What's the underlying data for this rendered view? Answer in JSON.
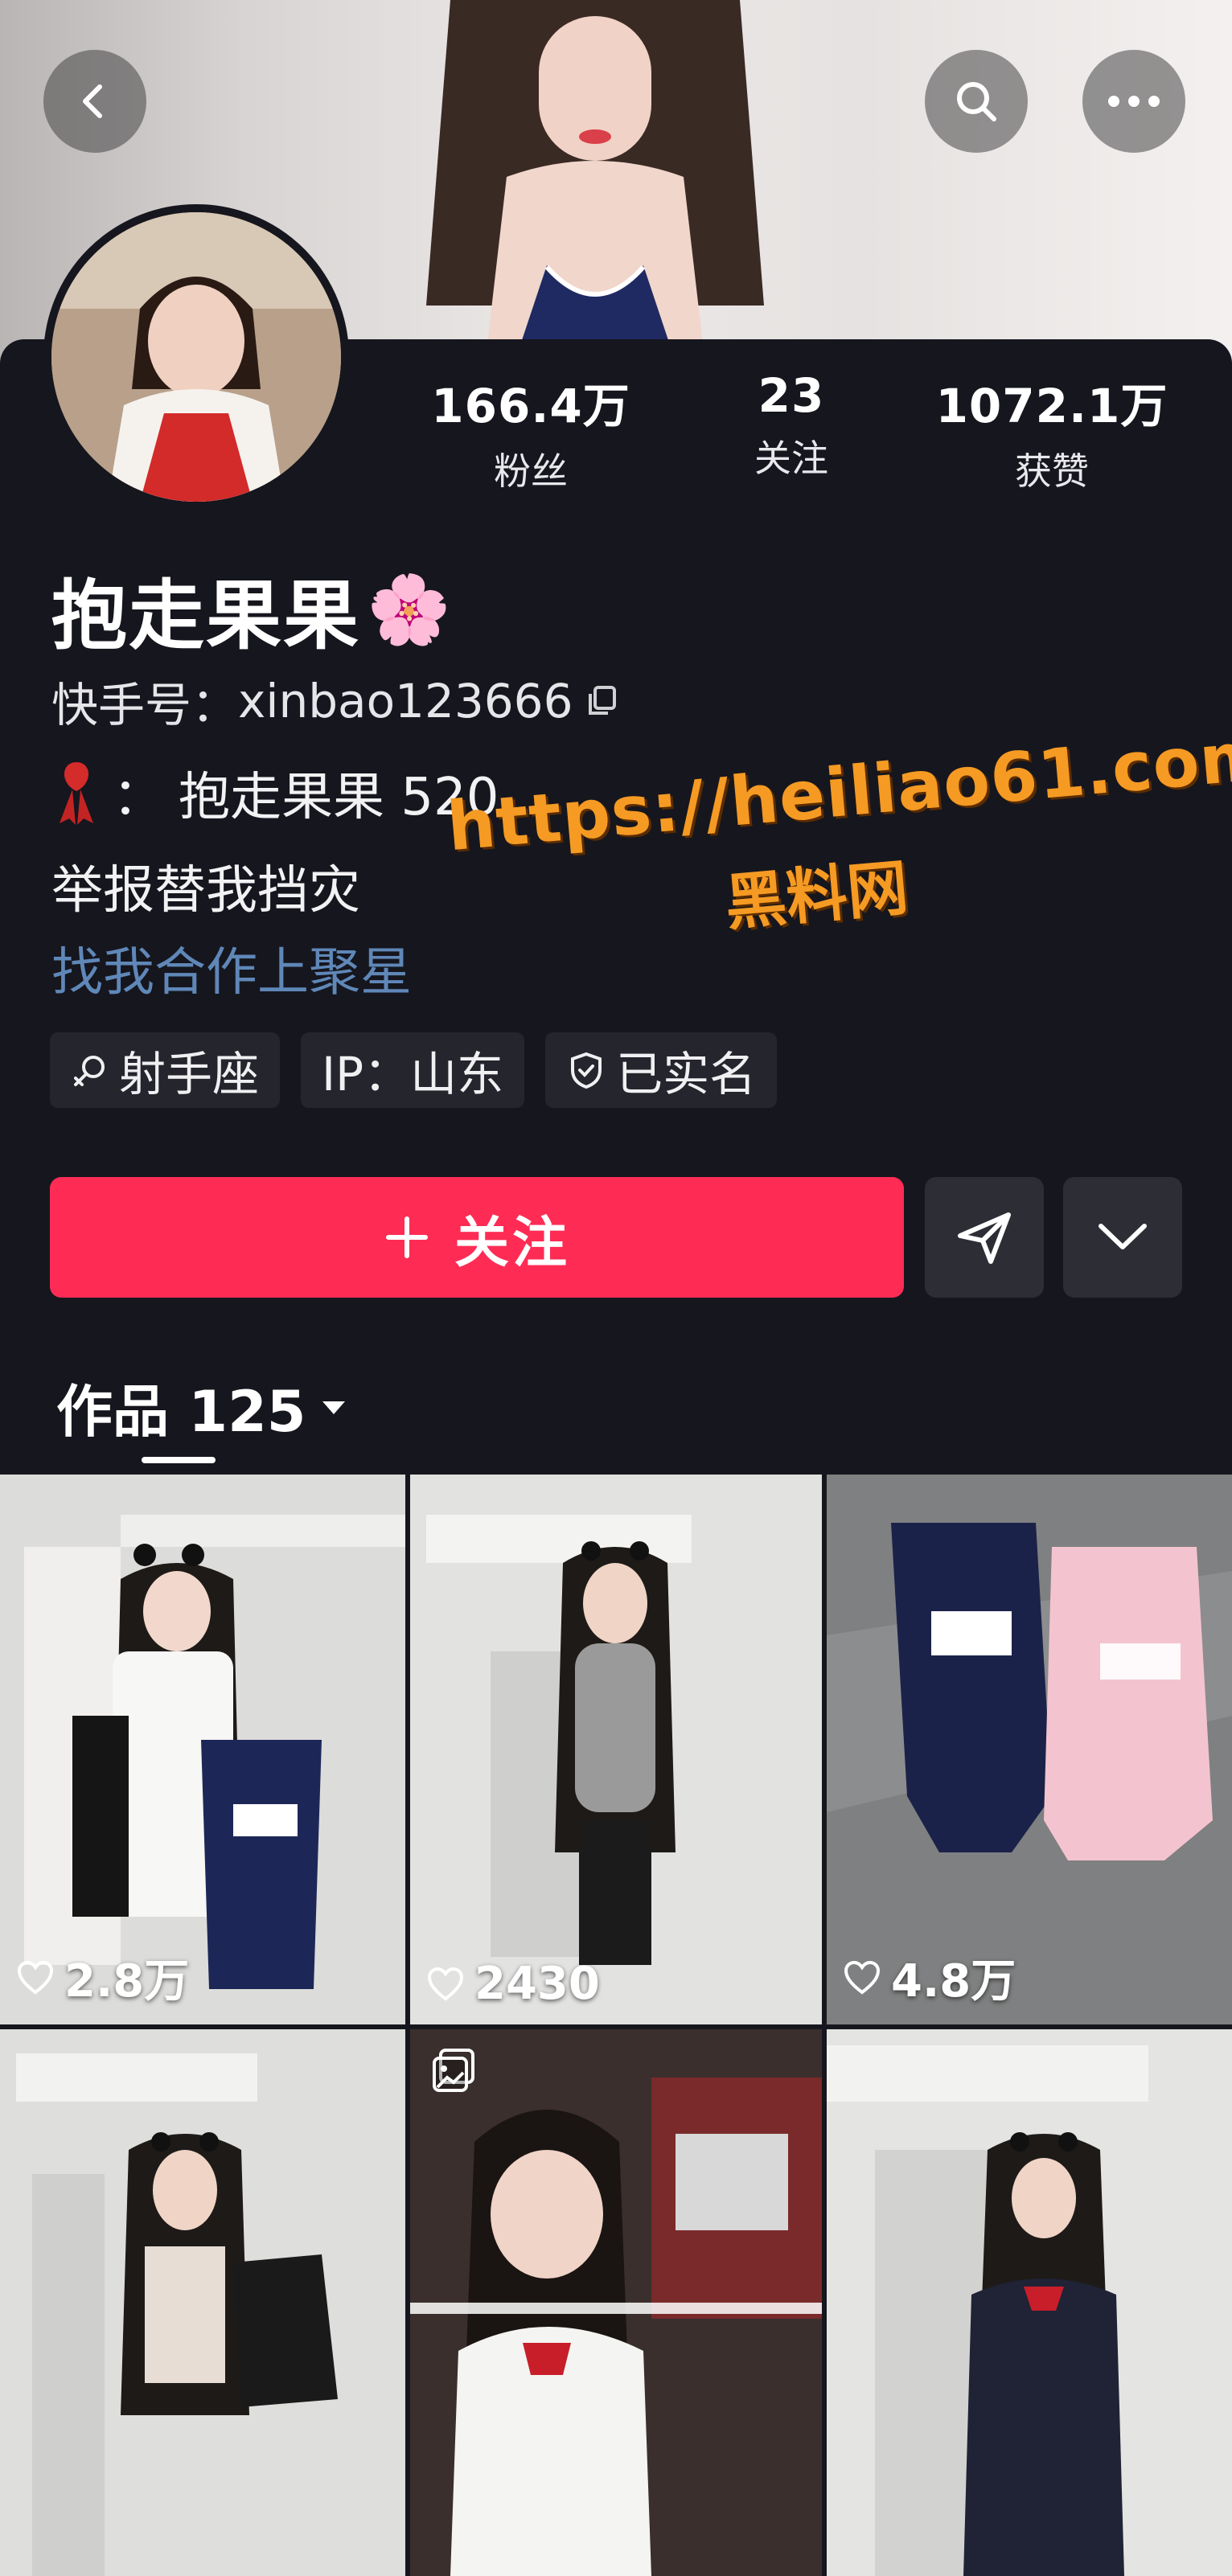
{
  "header": {
    "back_icon": "chevron-left-icon",
    "search_icon": "search-icon",
    "more_icon": "more-horizontal-icon"
  },
  "profile": {
    "stats": [
      {
        "value": "166.4万",
        "label": "粉丝"
      },
      {
        "value": "23",
        "label": "关注"
      },
      {
        "value": "1072.1万",
        "label": "获赞"
      }
    ],
    "name": "抱走果果",
    "name_emoji": "🌸",
    "uid_label": "快手号：",
    "uid_value": "xinbao123666",
    "bio_prefix": "：",
    "bio_line1": "抱走果果 520",
    "bio_line2": "举报替我挡灾",
    "bio_line3": "找我合作上聚星",
    "tags": [
      "射手座",
      "IP：山东",
      "已实名"
    ]
  },
  "actions": {
    "follow_label": "关注",
    "accent": "#fe2c55"
  },
  "watermark": {
    "url": "https://heiliao61.com",
    "name": "黑料网"
  },
  "works": {
    "label": "作品 125"
  },
  "grid": [
    {
      "likes": "2.8万"
    },
    {
      "likes": "2430"
    },
    {
      "likes": "4.8万"
    },
    {
      "likes": ""
    },
    {
      "likes": ""
    },
    {
      "likes": ""
    }
  ]
}
